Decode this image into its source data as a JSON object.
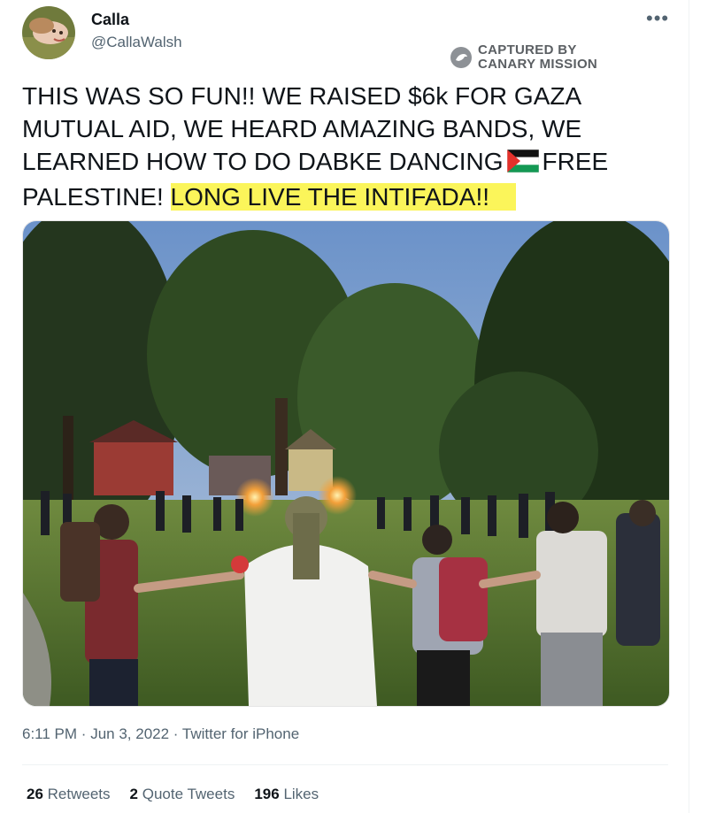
{
  "user": {
    "display_name": "Calla",
    "handle": "@CallaWalsh"
  },
  "menu_icon": "more-dots-icon",
  "watermark": {
    "line1": "CAPTURED BY",
    "line2": "CANARY MISSION",
    "icon": "canary-mission-logo"
  },
  "tweet": {
    "text_part1": "THIS WAS SO FUN!! WE RAISED $6k FOR GAZA MUTUAL AID, WE HEARD AMAZING BANDS, WE LEARNED HOW TO DO DABKE DANCING",
    "flag_icon": "palestine-flag-emoji",
    "text_part2": "FREE PALESTINE!",
    "highlighted": "LONG LIVE THE INTIFADA!!"
  },
  "meta": {
    "time": "6:11 PM",
    "date": "Jun 3, 2022",
    "client": "Twitter for iPhone",
    "dot": "·"
  },
  "stats": {
    "retweets_count": "26",
    "retweets_label": "Retweets",
    "quotes_count": "2",
    "quotes_label": "Quote Tweets",
    "likes_count": "196",
    "likes_label": "Likes"
  },
  "colors": {
    "highlight": "#fbf55a",
    "secondary_text": "#536471",
    "primary_text": "#0f1419"
  }
}
